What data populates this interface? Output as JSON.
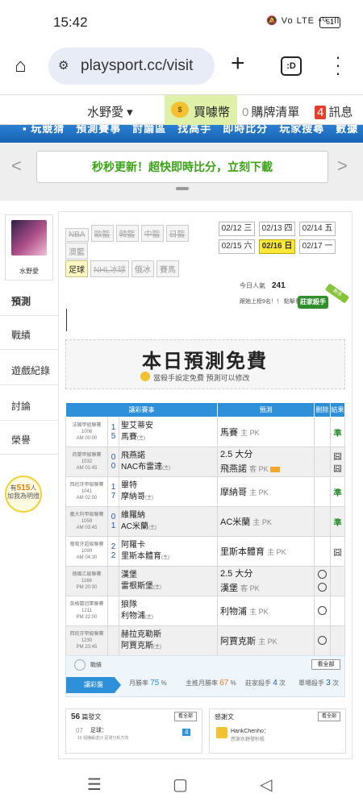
{
  "status": {
    "time": "15:42",
    "icons": "🔕 Vo LTE ⁴ᴳ ıll",
    "battery": "61"
  },
  "browser": {
    "url": "playsport.cc/visit",
    "tabs_label": ":D"
  },
  "header": {
    "user": "水野愛 ▾",
    "coin": "買噱幣",
    "cart_count": "0",
    "cart_label": "購牌清單",
    "msg_count": "4",
    "msg_label": "訊息"
  },
  "bluenav": {
    "items": "▪ 玩競猜　預測賽事　討論區　找高手　即時比分　玩家搜尋　數據"
  },
  "banner": {
    "text": "秒秒更新！超快即時比分，立刻下載"
  },
  "sidebar": {
    "username": "水野愛",
    "items": [
      "預測",
      "戰績",
      "遊戲紀錄",
      "討論",
      "榮譽"
    ],
    "bulb_prefix": "有",
    "bulb_count": "515",
    "bulb_unit": "人",
    "bulb_text": "加我為明燈"
  },
  "leagues": {
    "row1": [
      "NBA",
      "歐籃",
      "韓籃",
      "中籃",
      "日籃"
    ],
    "row2": [
      "澳籃"
    ],
    "row3": [
      "足球",
      "NHL冰球",
      "俄冰",
      "賽馬"
    ]
  },
  "dates": [
    "02/12 三",
    "02/13 四",
    "02/14 五",
    "02/15 六",
    "02/16 日",
    "02/17 一"
  ],
  "meta": {
    "today_label": "今日人氣",
    "today_count": "241",
    "rank": "跟她上榜9名！！ 點擊看"
  },
  "badge": {
    "ribbon": "莊家殺手",
    "ribbon2": "新手"
  },
  "promo": {
    "title": "本日預測免費",
    "subtitle": "當殺手設定免費  預測可以修改"
  },
  "table": {
    "headers": [
      "讓彩賽事",
      "預測",
      "刪除",
      "結果"
    ],
    "rows": [
      {
        "league": "法國甲組聯賽",
        "code": "1006",
        "time": "AM 00:00",
        "s1": "1",
        "s2": "5",
        "t1": "聖艾蒂安",
        "t2": "馬賽",
        "t2sub": "(主)",
        "picks": [
          {
            "txt": "馬賽",
            "sub": "主 PK",
            "hot": false
          }
        ],
        "res": "準",
        "win": true
      },
      {
        "league": "荷蘭甲級聯賽",
        "code": "1032",
        "time": "AM 01:45",
        "s1": "0",
        "s2": "0",
        "t1": "飛燕諾",
        "t2": "NAC布雷達",
        "t2sub": "(主)",
        "picks": [
          {
            "txt": "2.5 大分",
            "sub": "",
            "hot": false
          },
          {
            "txt": "飛燕諾",
            "sub": "客 PK",
            "hot": true
          }
        ],
        "res": "囧",
        "res2": "囧",
        "win": false
      },
      {
        "league": "西班牙甲級聯賽",
        "code": "1041",
        "time": "AM 02:00",
        "s1": "1",
        "s2": "7",
        "t1": "畢特",
        "t2": "摩納哥",
        "t2sub": "(主)",
        "picks": [
          {
            "txt": "摩納哥",
            "sub": "主 PK",
            "hot": false
          }
        ],
        "res": "準",
        "win": true
      },
      {
        "league": "義大利甲級聯賽",
        "code": "1059",
        "time": "AM 03:45",
        "s1": "0",
        "s2": "1",
        "t1": "維羅納",
        "t2": "AC米蘭",
        "t2sub": "(主)",
        "picks": [
          {
            "txt": "AC米蘭",
            "sub": "主 PK",
            "hot": false
          }
        ],
        "res": "準",
        "win": true
      },
      {
        "league": "葡萄牙超級聯賽",
        "code": "1090",
        "time": "AM 04:30",
        "s1": "2",
        "s2": "2",
        "t1": "阿羅卡",
        "t2": "里斯本體育",
        "t2sub": "(主)",
        "picks": [
          {
            "txt": "里斯本體育",
            "sub": "主 PK",
            "hot": false
          }
        ],
        "res": "囧",
        "win": false
      },
      {
        "league": "德國乙級聯賽",
        "code": "1166",
        "time": "PM 20:30",
        "s1": "",
        "s2": "",
        "t1": "漢堡",
        "t2": "雷根斯堡",
        "t2sub": "(主)",
        "picks": [
          {
            "txt": "2.5 大分",
            "sub": "",
            "hot": false
          },
          {
            "txt": "漢堡",
            "sub": "客 PK",
            "hot": false
          }
        ],
        "res": "",
        "win": false,
        "circles": 2
      },
      {
        "league": "英格蘭冠軍聯賽",
        "code": "1211",
        "time": "PM 22:00",
        "s1": "",
        "s2": "",
        "t1": "狼隊",
        "t2": "利物浦",
        "t2sub": "(主)",
        "picks": [
          {
            "txt": "利物浦",
            "sub": "主 PK",
            "hot": false
          }
        ],
        "res": "",
        "win": false,
        "circles": 1
      },
      {
        "league": "西班牙甲級聯賽",
        "code": "1230",
        "time": "PM 23:45",
        "s1": "",
        "s2": "",
        "t1": "赫拉克勒斯",
        "t2": "阿賈克斯",
        "t2sub": "(主)",
        "picks": [
          {
            "txt": "阿賈克斯",
            "sub": "主 PK",
            "hot": false
          }
        ],
        "res": "",
        "win": false,
        "circles": 1
      }
    ]
  },
  "stats": {
    "title": "戰績",
    "more": "看全部",
    "tag": "讓彩盤",
    "m_label": "月勝率",
    "m_val": "75",
    "m_unit": "%",
    "t_label": "主推月勝率",
    "t_val": "67",
    "t_unit": "%",
    "k_label": "莊家殺手",
    "k_val": "4",
    "k_unit": "次",
    "s_label": "單場殺手",
    "s_val": "3",
    "s_unit": "次"
  },
  "panels": {
    "left": {
      "count": "56",
      "label": "篇發文",
      "more": "看全部",
      "item_no": "07",
      "item_title": "足球：",
      "item_sub": "10  週播級送沙 足球分析方向",
      "badge": "4"
    },
    "right": {
      "label": "感謝文",
      "more": "看全部",
      "author": "HankChenho：",
      "msg": "感謝水野發秒殺"
    }
  }
}
